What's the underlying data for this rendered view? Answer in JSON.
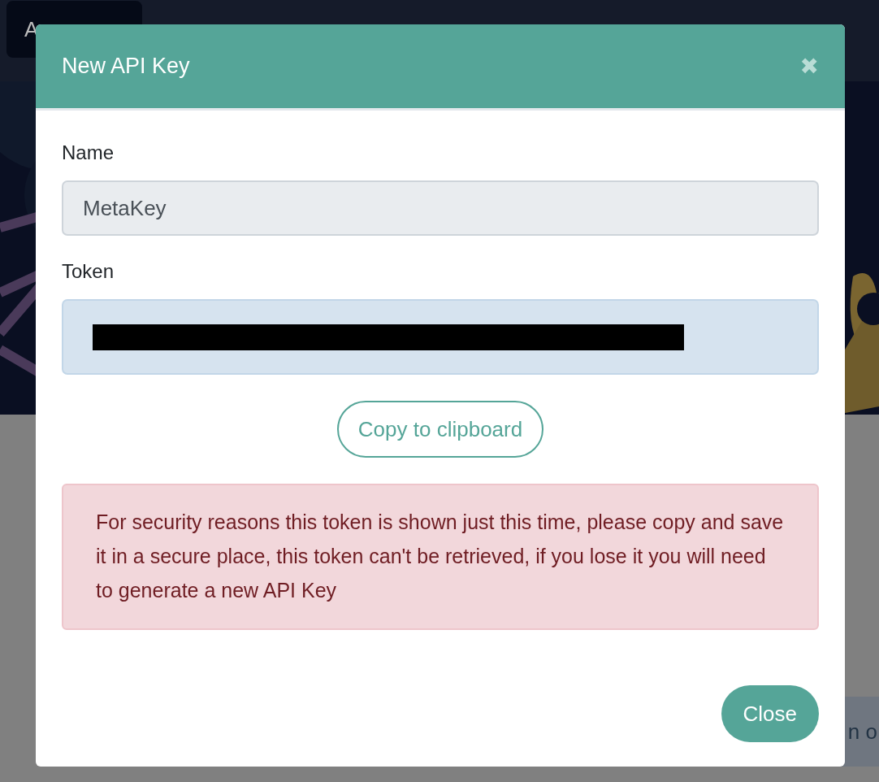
{
  "background": {
    "top_button": {
      "label": "A"
    },
    "card": {
      "text": "n o"
    }
  },
  "dialog": {
    "title": "New API Key",
    "close_icon": "✖",
    "fields": [
      {
        "label": "Name",
        "value": "MetaKey",
        "kind": "readonly"
      },
      {
        "label": "Token",
        "kind": "redacted"
      }
    ],
    "copy_button": "Copy to clipboard",
    "alert": "For security reasons this token is shown just this time, please copy and save it in a secure place, this token can't be retrieved, if you lose it you will need to generate a new API Key",
    "close_button": "Close"
  }
}
